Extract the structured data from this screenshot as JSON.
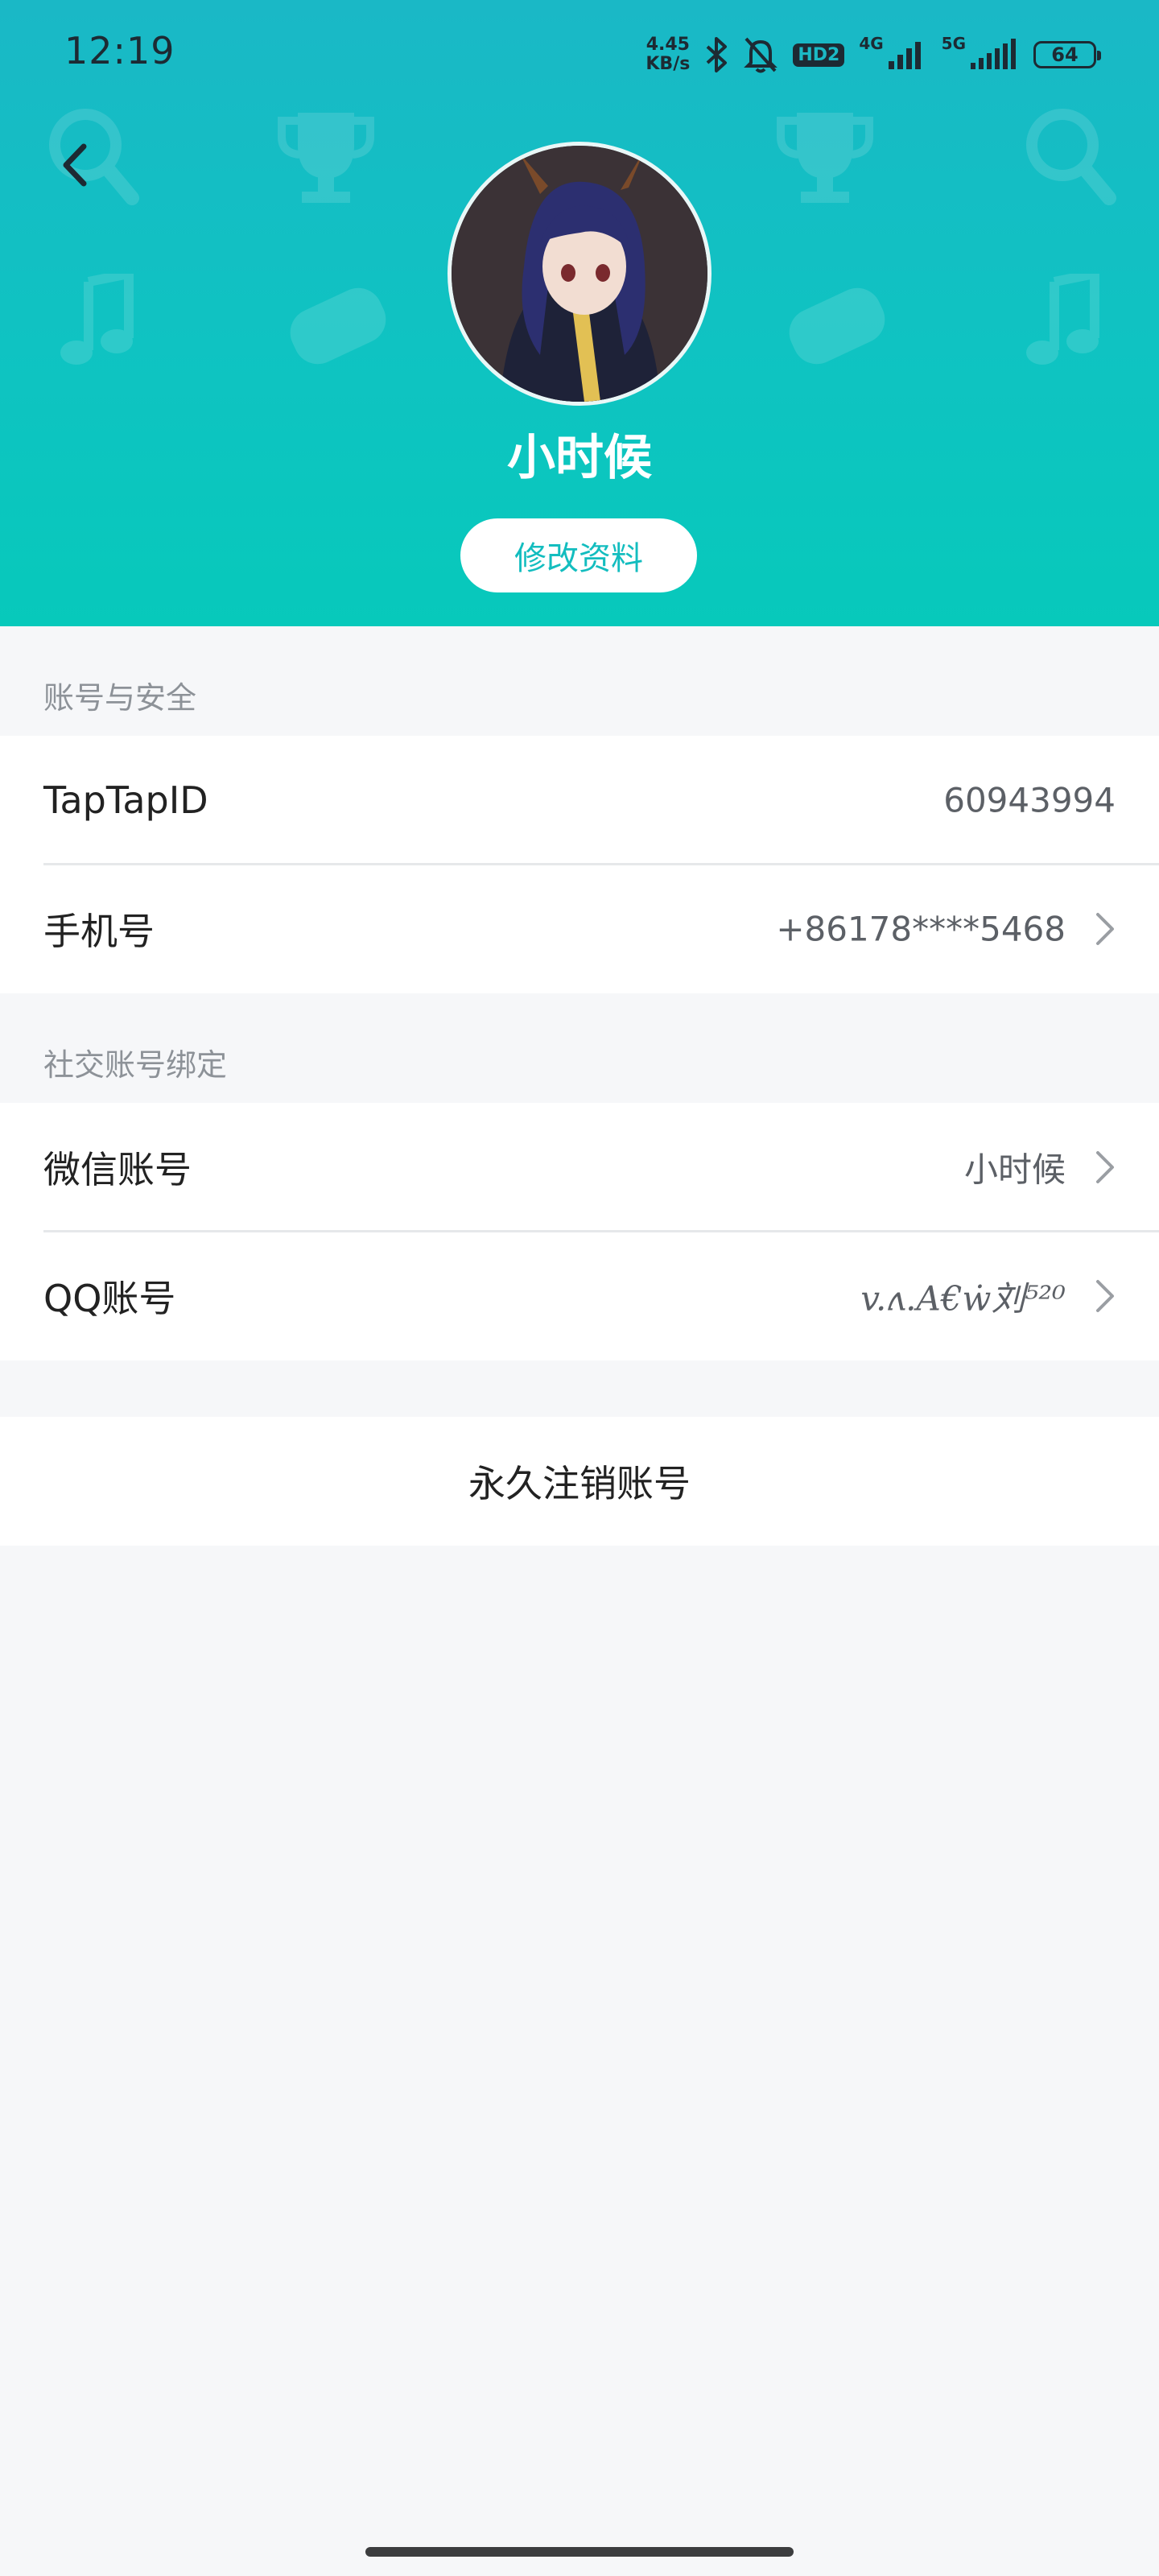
{
  "status_bar": {
    "time": "12:19",
    "speed_value": "4.45",
    "speed_unit": "KB/s",
    "hd_badge": "HD2",
    "network_1": "4G",
    "network_2": "5G",
    "battery": "64"
  },
  "header": {
    "username": "小时候",
    "edit_button": "修改资料"
  },
  "account_section": {
    "title": "账号与安全",
    "rows": [
      {
        "label": "TapTapID",
        "value": "60943994"
      },
      {
        "label": "手机号",
        "value": "+86178****5468"
      }
    ]
  },
  "social_section": {
    "title": "社交账号绑定",
    "rows": [
      {
        "label": "微信账号",
        "value": "小时候"
      },
      {
        "label": "QQ账号",
        "value": "v.ʌ.A€ẇ刘⁵²⁰"
      }
    ]
  },
  "delete_account": "永久注销账号",
  "colors": {
    "header_gradient_top": "#1ab8c6",
    "header_gradient_bottom": "#07c9bb",
    "accent": "#13bdbf",
    "page_background": "#f6f7f9"
  }
}
